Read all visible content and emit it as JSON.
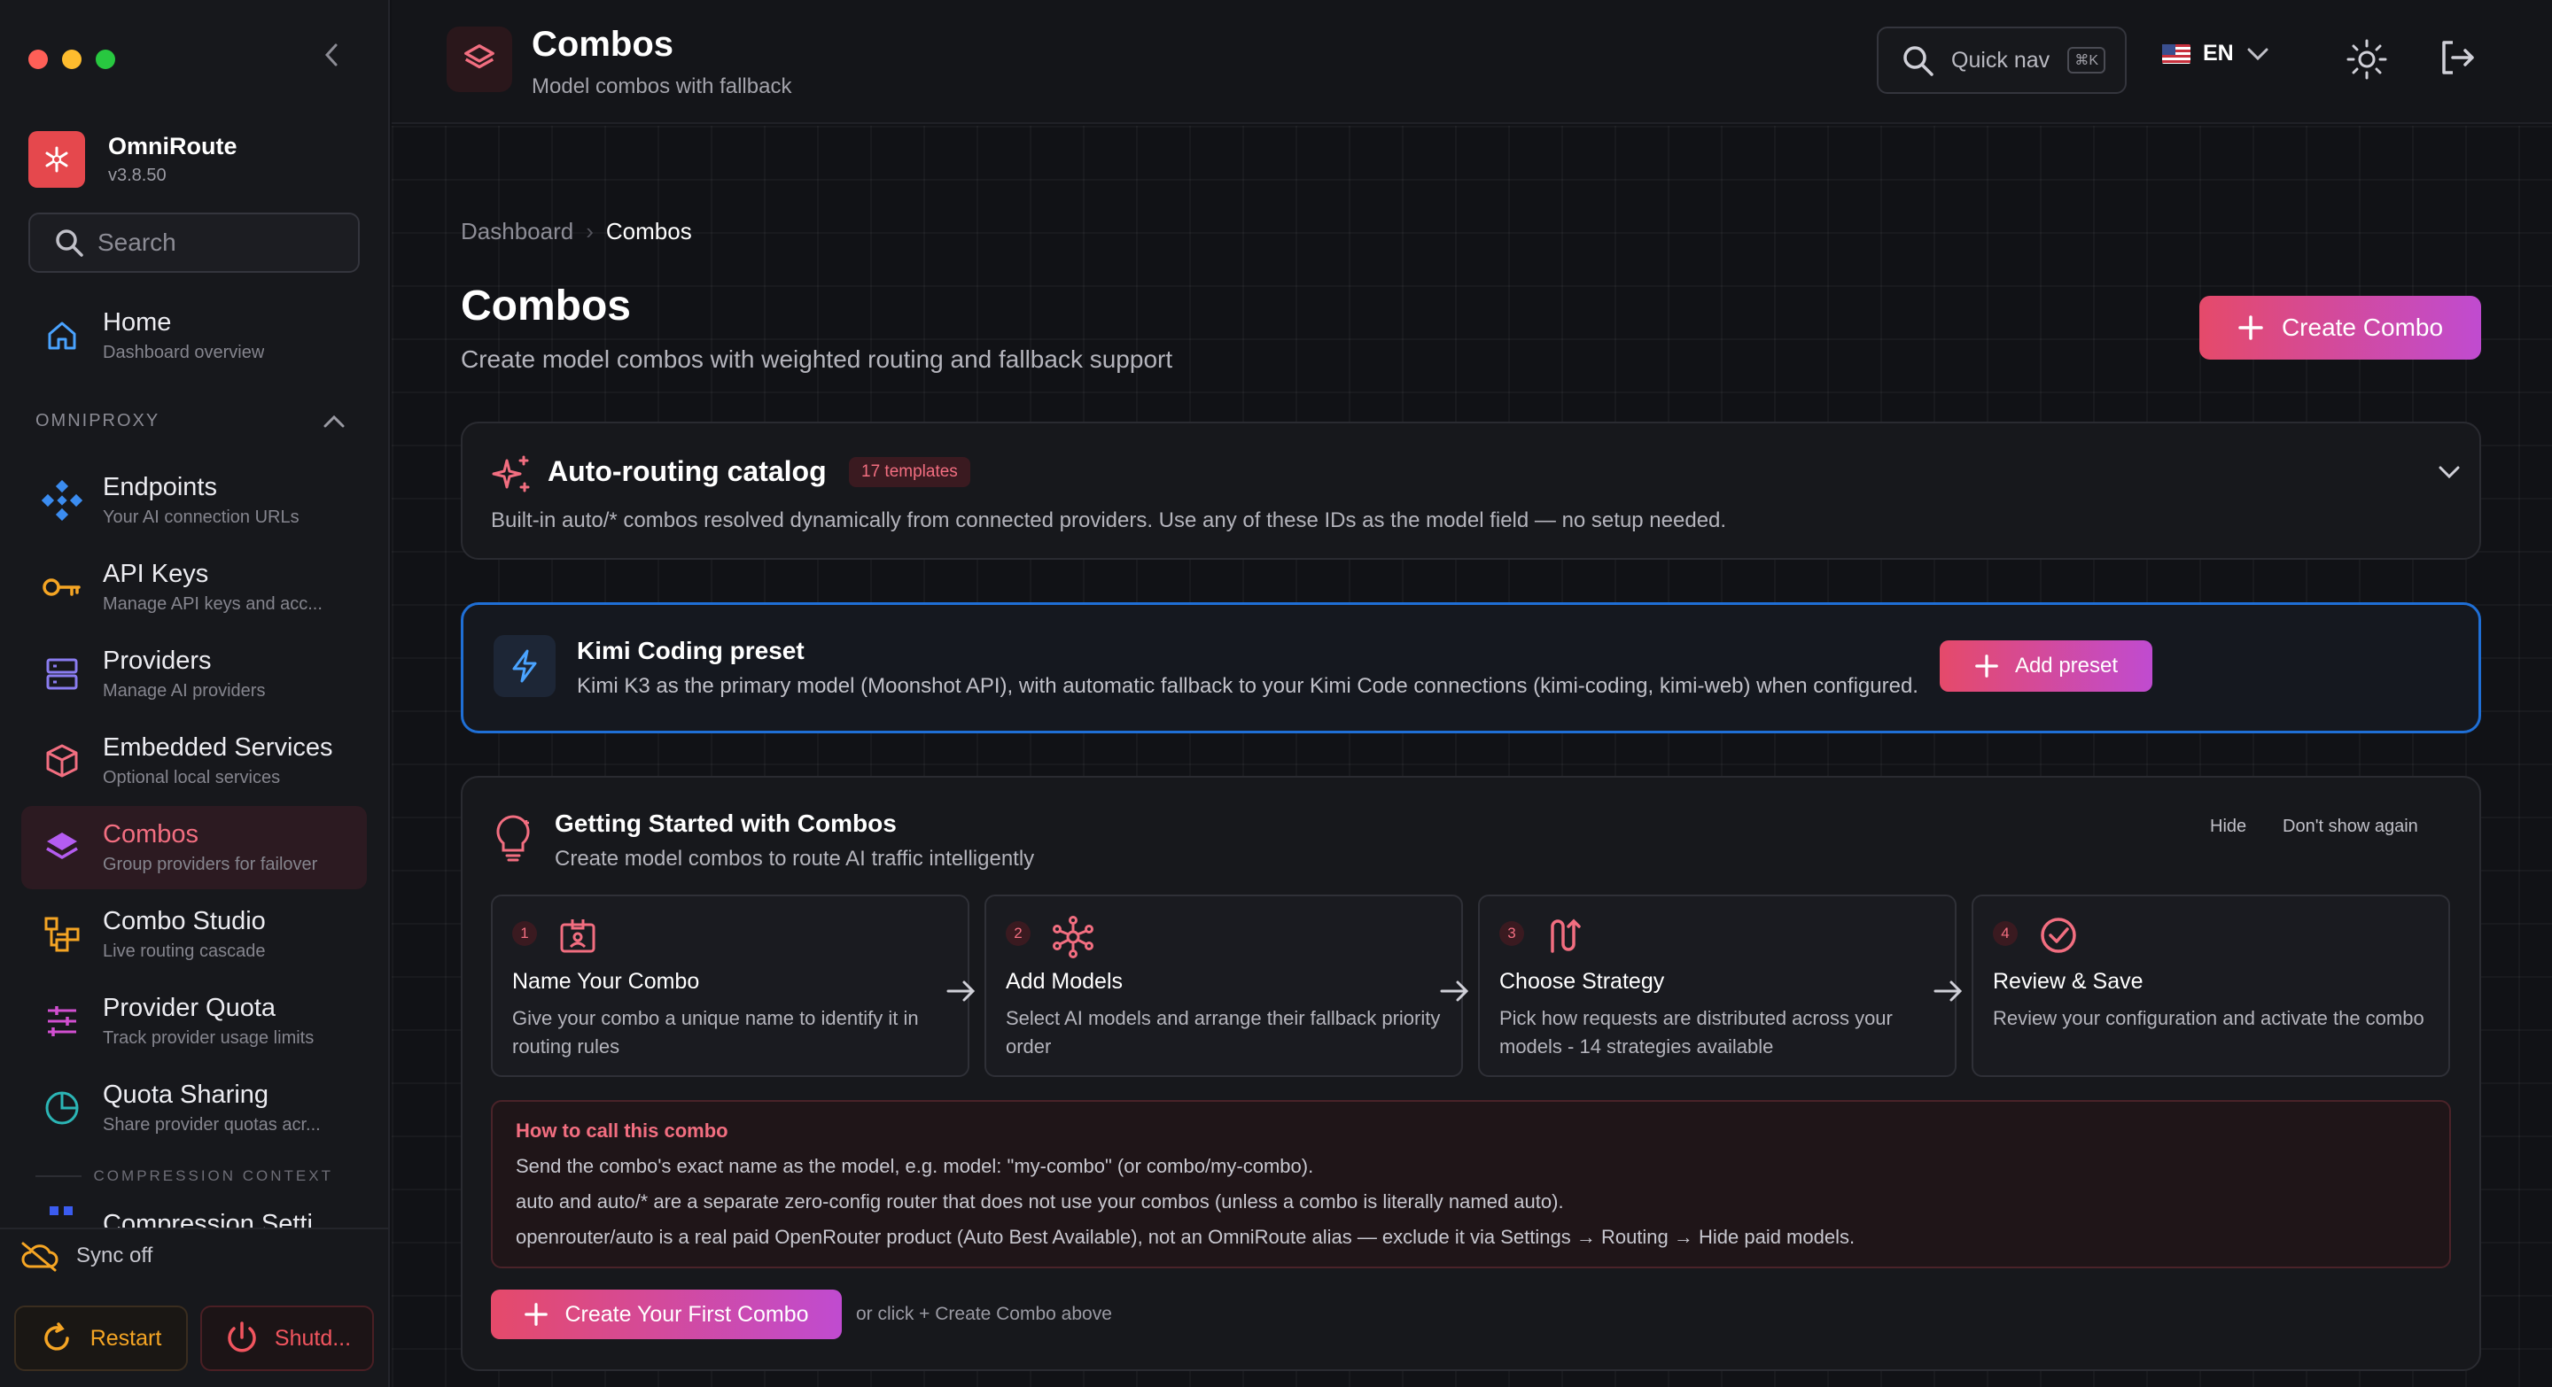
{
  "window": {
    "traffic_lights": [
      "#ff5f57",
      "#febc2e",
      "#28c840"
    ]
  },
  "app": {
    "name": "OmniRoute",
    "version": "v3.8.50",
    "accent": "#e5484d"
  },
  "sidebar": {
    "search_placeholder": "Search",
    "home": {
      "label": "Home",
      "sub": "Dashboard overview",
      "icon": "home-icon"
    },
    "section": "OMNIPROXY",
    "items": [
      {
        "label": "Endpoints",
        "sub": "Your AI connection URLs",
        "icon": "endpoints-icon"
      },
      {
        "label": "API Keys",
        "sub": "Manage API keys and acc...",
        "icon": "key-icon"
      },
      {
        "label": "Providers",
        "sub": "Manage AI providers",
        "icon": "server-icon"
      },
      {
        "label": "Embedded Services",
        "sub": "Optional local services",
        "icon": "cube-icon"
      },
      {
        "label": "Combos",
        "sub": "Group providers for failover",
        "icon": "layers-icon",
        "active": true
      },
      {
        "label": "Combo Studio",
        "sub": "Live routing cascade",
        "icon": "workflow-icon"
      },
      {
        "label": "Provider Quota",
        "sub": "Track provider usage limits",
        "icon": "sliders-icon"
      },
      {
        "label": "Quota Sharing",
        "sub": "Share provider quotas acr...",
        "icon": "pie-icon"
      },
      {
        "label": "Compression Setti",
        "sub": "",
        "icon": "compress-icon"
      }
    ],
    "section2": "COMPRESSION CONTEXT",
    "sync_label": "Sync off",
    "restart_label": "Restart",
    "shutdown_label": "Shutd..."
  },
  "topbar": {
    "title": "Combos",
    "subtitle": "Model combos with fallback",
    "quicknav_label": "Quick nav",
    "quicknav_kbd": "⌘K",
    "lang": "EN"
  },
  "page": {
    "breadcrumb": [
      "Dashboard",
      "Combos"
    ],
    "title": "Combos",
    "subtitle": "Create model combos with weighted routing and fallback support",
    "create_button": "Create Combo"
  },
  "catalog": {
    "title": "Auto-routing catalog",
    "badge": "17 templates",
    "desc": "Built-in auto/* combos resolved dynamically from connected providers. Use any of these IDs as the model field — no setup needed."
  },
  "kimi": {
    "title": "Kimi Coding preset",
    "desc": "Kimi K3 as the primary model (Moonshot API), with automatic fallback to your Kimi Code connections (kimi-coding, kimi-web) when configured.",
    "button": "Add preset"
  },
  "getting_started": {
    "title": "Getting Started with Combos",
    "subtitle": "Create model combos to route AI traffic intelligently",
    "hide": "Hide",
    "dont_show": "Don't show again",
    "steps": [
      {
        "num": "1",
        "title": "Name Your Combo",
        "desc": "Give your combo a unique name to identify it in routing rules",
        "icon": "id-card-icon"
      },
      {
        "num": "2",
        "title": "Add Models",
        "desc": "Select AI models and arrange their fallback priority order",
        "icon": "network-icon"
      },
      {
        "num": "3",
        "title": "Choose Strategy",
        "desc": "Pick how requests are distributed across your models - 14 strategies available",
        "icon": "route-icon"
      },
      {
        "num": "4",
        "title": "Review & Save",
        "desc": "Review your configuration and activate the combo",
        "icon": "check-circle-icon"
      }
    ],
    "howto": {
      "title": "How to call this combo",
      "lines": [
        "Send the combo's exact name as the model, e.g. model: \"my-combo\" (or combo/my-combo).",
        "auto and auto/* are a separate zero-config router that does not use your combos (unless a combo is literally named auto).",
        "openrouter/auto is a real paid OpenRouter product (Auto Best Available), not an OmniRoute alias — exclude it via Settings → Routing → Hide paid models."
      ]
    },
    "first_button": "Create Your First Combo",
    "or_text": "or click + Create Combo above"
  }
}
